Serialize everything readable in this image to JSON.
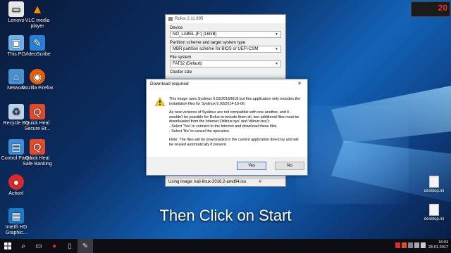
{
  "desktop_icons": [
    {
      "label": "Lenovo",
      "color": "#e8e8e8"
    },
    {
      "label": "VLC media player",
      "color": "#f18a00"
    },
    {
      "label": "This PC",
      "color": "#6fb1e8"
    },
    {
      "label": "VideoScribe",
      "color": "#2a7fd4"
    },
    {
      "label": "Network",
      "color": "#4a8fd0"
    },
    {
      "label": "Mozilla Firefox",
      "color": "#e66000"
    },
    {
      "label": "Recycle Bin",
      "color": "#bcd3ea"
    },
    {
      "label": "Quick Heal Secure Br...",
      "color": "#e14b2c"
    },
    {
      "label": "Control Panel",
      "color": "#3d8ed9"
    },
    {
      "label": "Quick Heal Safe Banking",
      "color": "#e14b2c"
    },
    {
      "label": "Action!",
      "color": "#d82a2a"
    },
    {
      "label": "Intel® HD Graphic...",
      "color": "#1e78c8"
    }
  ],
  "right_icons": [
    {
      "label": "desktop.ini"
    },
    {
      "label": "desktop.ini"
    }
  ],
  "rufus": {
    "title": "Rufus 2.11.995",
    "device_label": "Device",
    "device_value": "NO_LABEL (F:) [16GB]",
    "partition_label": "Partition scheme and target system type",
    "partition_value": "MBR partition scheme for BIOS or UEFI-CSM",
    "fs_label": "File system",
    "fs_value": "FAT32 (Default)",
    "cluster_label": "Cluster size",
    "status_text": "Using image: kali-linux-2016.2-amd64.iso",
    "status_hash": "#"
  },
  "dialog": {
    "title": "Download required",
    "close": "✕",
    "p1": "This image uses Syslinux 6.03/20160618 but this application only includes the installation files for Syslinux 6.03/2014-10-06.",
    "p2": "As new versions of Syslinux are not compatible with one another, and it wouldn't be possible for Rufus to include them all, two additional files must be downloaded from the Internet ('ldlinux.sys' and 'ldlinux.bss'):",
    "p3a": "- Select 'Yes' to connect to the Internet and download these files",
    "p3b": "- Select 'No' to cancel the operation",
    "p4": "Note: The files will be downloaded in the current application directory and will be reused automatically if present.",
    "yes": "Yes",
    "no": "No"
  },
  "caption": "Then Click on Start",
  "widget": {
    "value": "20"
  },
  "taskbar": {
    "time": "16:03",
    "date": "28-01-2017"
  },
  "colors": {
    "accent": "#1363b8",
    "dialog_border": "#5e87c0"
  }
}
